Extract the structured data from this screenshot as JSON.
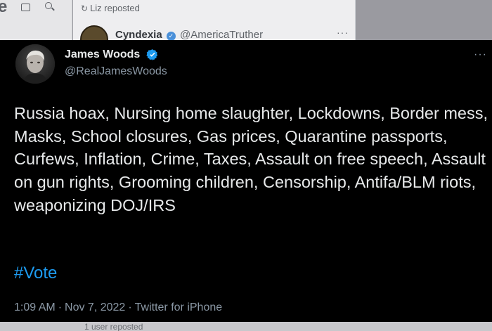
{
  "background": {
    "page_title_fragment": "e",
    "repost_line": "Liz reposted",
    "author_name": "Cyndexia",
    "author_handle": "@AmericaTruther",
    "bottom_line": "1 user reposted"
  },
  "tweet": {
    "author": {
      "name": "James Woods",
      "handle": "@RealJamesWoods"
    },
    "body": "Russia hoax, Nursing home slaughter, Lockdowns, Border mess, Masks, School closures, Gas prices, Quarantine passports, Curfews, Inflation, Crime, Taxes, Assault on free speech, Assault on gun rights, Grooming children, Censorship, Antifa/BLM riots, weaponizing DOJ/IRS",
    "hashtag": "#Vote",
    "time": "1:09 AM",
    "date": "Nov 7, 2022",
    "source": "Twitter for iPhone",
    "separator": "·"
  },
  "colors": {
    "tweet_background": "#000000",
    "text_primary": "#e7e9ea",
    "text_secondary": "#8b98a5",
    "link_blue": "#1d9bf0",
    "verified_blue": "#1d9bf0"
  },
  "icons": {
    "verified": "verified-badge-icon",
    "more": "more-options-icon",
    "repost": "repost-icon",
    "calendar": "calendar-icon",
    "search": "search-icon"
  }
}
